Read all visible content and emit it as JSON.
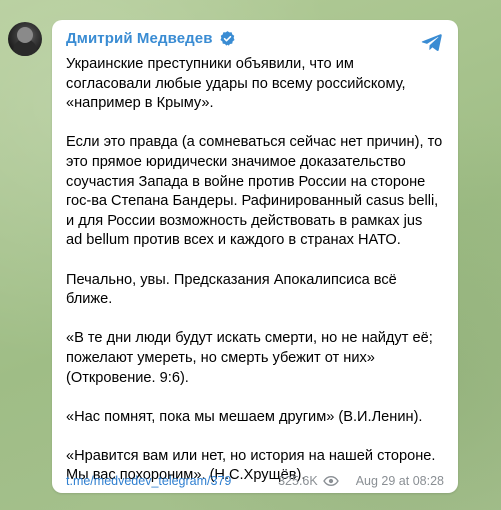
{
  "channel": {
    "name": "Дмитрий Медведев",
    "verified": true,
    "avatar": "person-photo"
  },
  "message": {
    "paragraphs": [
      "Украинские преступники объявили, что им\nсогласовали любые удары по всему российскому,\n«например в Крыму».",
      "Если это правда (а сомневаться сейчас нет причин), то\nэто прямое юридически значимое доказательство\nсоучастия Запада в войне против России на стороне\nгос-ва Степана Бандеры. Рафинированный casus belli,\nи для России возможность действовать в рамках jus\nad bellum против всех и каждого в странах НАТО.",
      "Печально, увы. Предсказания Апокалипсиса всё\nближе.",
      "«В те дни люди будут искать смерти, но не найдут её;\nпожелают умереть, но смерть убежит от них»\n(Откровение. 9:6).",
      "«Нас помнят, пока мы мешаем другим» (В.И.Ленин).",
      "«Нравится вам или нет, но история на нашей стороне.\nМы вас похороним». (Н.С.Хрущёв)."
    ]
  },
  "footer": {
    "link": "t.me/medvedev_telegram/379",
    "views": "325.6K",
    "date": "Aug 29 at 08:28"
  },
  "icons": {
    "verified": "verified-badge-icon",
    "share": "telegram-share-icon",
    "views": "eye-icon"
  },
  "colors": {
    "accent": "#3a8cd3",
    "link": "#2f7fd0",
    "meta": "#8a8f94",
    "background": "#a7c38f"
  }
}
